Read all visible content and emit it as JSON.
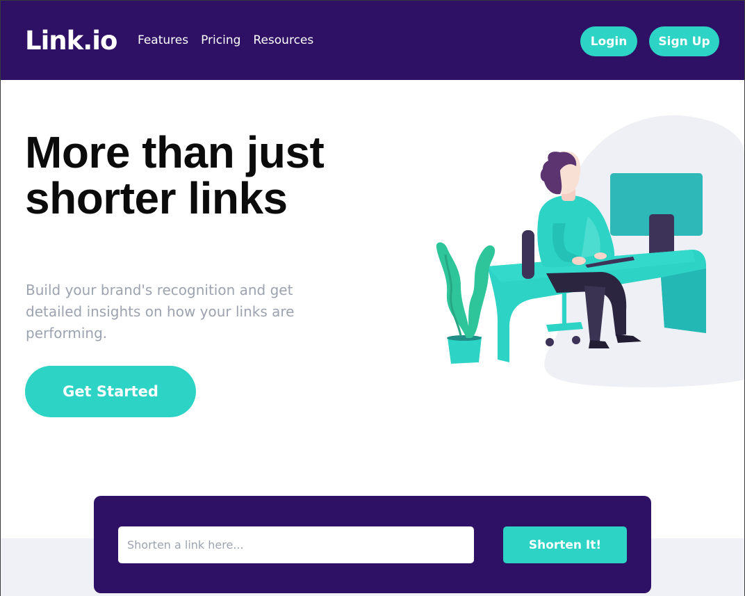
{
  "brand": {
    "logo": "Link.io"
  },
  "nav": {
    "links": [
      "Features",
      "Pricing",
      "Resources"
    ],
    "login_label": "Login",
    "signup_label": "Sign Up"
  },
  "hero": {
    "title": "More than just shorter links",
    "subtitle": "Build your brand's recognition and get detailed insights on how your links are performing.",
    "cta_label": "Get Started",
    "illustration_icon": "person-working-at-desk-illustration"
  },
  "shortener": {
    "placeholder": "Shorten a link here...",
    "button_label": "Shorten It!"
  },
  "colors": {
    "primary_dark": "#2e1065",
    "accent_cyan": "#2dd4c5",
    "text_dark": "#0b0b0b",
    "text_muted": "#9ca3af",
    "band_gray": "#f0f1f6"
  }
}
